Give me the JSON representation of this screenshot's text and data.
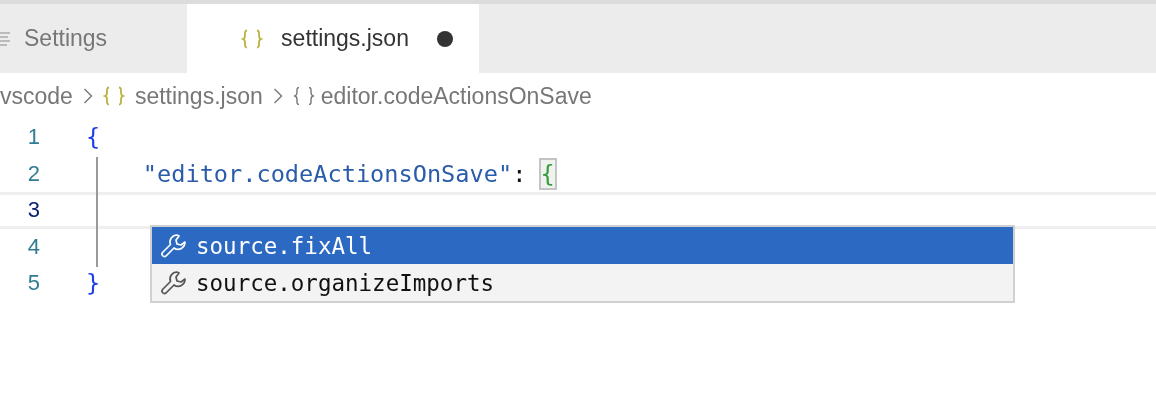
{
  "tabs": [
    {
      "label": "Settings",
      "kind": "list",
      "selected": false,
      "dirty": false
    },
    {
      "label": "settings.json",
      "kind": "braces",
      "selected": true,
      "dirty": true
    }
  ],
  "breadcrumb": [
    {
      "label": "vscode",
      "kind": "folder"
    },
    {
      "label": "settings.json",
      "kind": "braces"
    },
    {
      "label": "editor.codeActionsOnSave",
      "kind": "object"
    }
  ],
  "lines": [
    {
      "number": "1",
      "current": false,
      "tokens": [
        {
          "text": "{",
          "kind": "bracket"
        }
      ]
    },
    {
      "number": "2",
      "current": false,
      "tokens": [
        {
          "text": "    \"editor.codeActionsOnSave\"",
          "kind": "string"
        },
        {
          "text": ": ",
          "kind": "punct"
        },
        {
          "text": "{",
          "kind": "bracket-matched"
        }
      ]
    },
    {
      "number": "3",
      "current": true
    },
    {
      "number": "4",
      "current": false
    },
    {
      "number": "5",
      "current": false,
      "tokens": [
        {
          "text": "}",
          "kind": "bracket"
        }
      ]
    }
  ],
  "suggestions": [
    {
      "label": "source.fixAll",
      "selected": true
    },
    {
      "label": "source.organizeImports",
      "selected": false
    }
  ]
}
